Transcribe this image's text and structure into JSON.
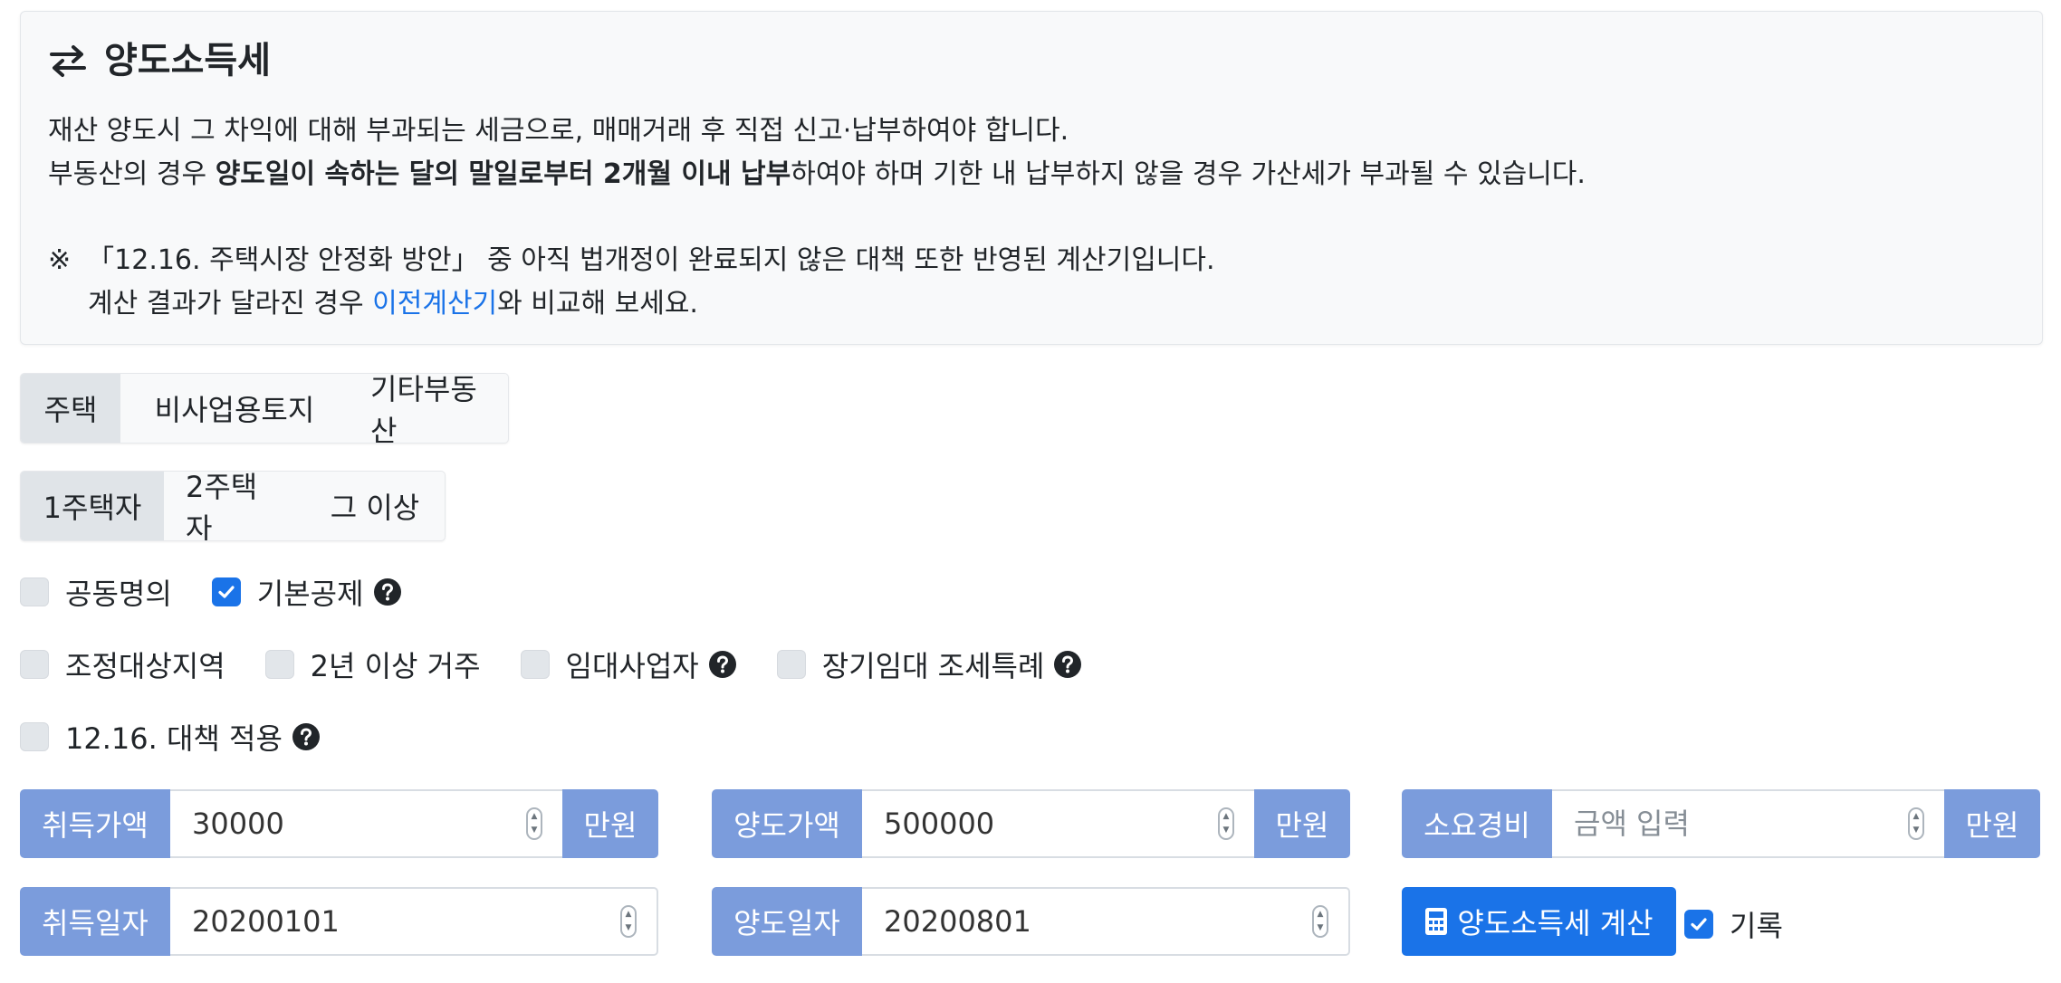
{
  "intro": {
    "title": "양도소득세",
    "line1": "재산 양도시 그 차익에 대해 부과되는 세금으로, 매매거래 후 직접 신고·납부하여야 합니다.",
    "line2_pre": "부동산의 경우 ",
    "line2_bold": "양도일이 속하는 달의 말일로부터 2개월 이내 납부",
    "line2_post": "하여야 하며 기한 내 납부하지 않을 경우 가산세가 부과될 수 있습니다.",
    "note_mark": "※",
    "note_line1": "「12.16. 주택시장 안정화 방안」 중 아직 법개정이 완료되지 않은 대책 또한 반영된 계산기입니다.",
    "note_line2_pre": "계산 결과가 달라진 경우 ",
    "note_link": "이전계산기",
    "note_line2_post": "와 비교해 보세요."
  },
  "property_tabs": [
    "주택",
    "비사업용토지",
    "기타부동산"
  ],
  "property_active": 0,
  "owner_tabs": [
    "1주택자",
    "2주택자",
    "그 이상"
  ],
  "owner_active": 0,
  "checkboxes": {
    "joint": {
      "label": "공동명의",
      "checked": false
    },
    "basic_deduction": {
      "label": "기본공제",
      "checked": true
    },
    "regulated_area": {
      "label": "조정대상지역",
      "checked": false
    },
    "residence_2y": {
      "label": "2년 이상 거주",
      "checked": false
    },
    "rental_business": {
      "label": "임대사업자",
      "checked": false
    },
    "long_term_rental": {
      "label": "장기임대 조세특례",
      "checked": false
    },
    "policy_1216": {
      "label": "12.16. 대책 적용",
      "checked": false
    }
  },
  "fields": {
    "acquisition_price": {
      "label": "취득가액",
      "value": "30000",
      "unit": "만원"
    },
    "transfer_price": {
      "label": "양도가액",
      "value": "500000",
      "unit": "만원"
    },
    "expenses": {
      "label": "소요경비",
      "value": "",
      "placeholder": "금액 입력",
      "unit": "만원"
    },
    "acquisition_date": {
      "label": "취득일자",
      "value": "20200101"
    },
    "transfer_date": {
      "label": "양도일자",
      "value": "20200801"
    }
  },
  "calculate_button": "양도소득세 계산",
  "record": {
    "label": "기록",
    "checked": true
  },
  "colors": {
    "accent": "#1a73e8",
    "addon": "#7b9cdc",
    "panel": "#f8f9fa"
  }
}
